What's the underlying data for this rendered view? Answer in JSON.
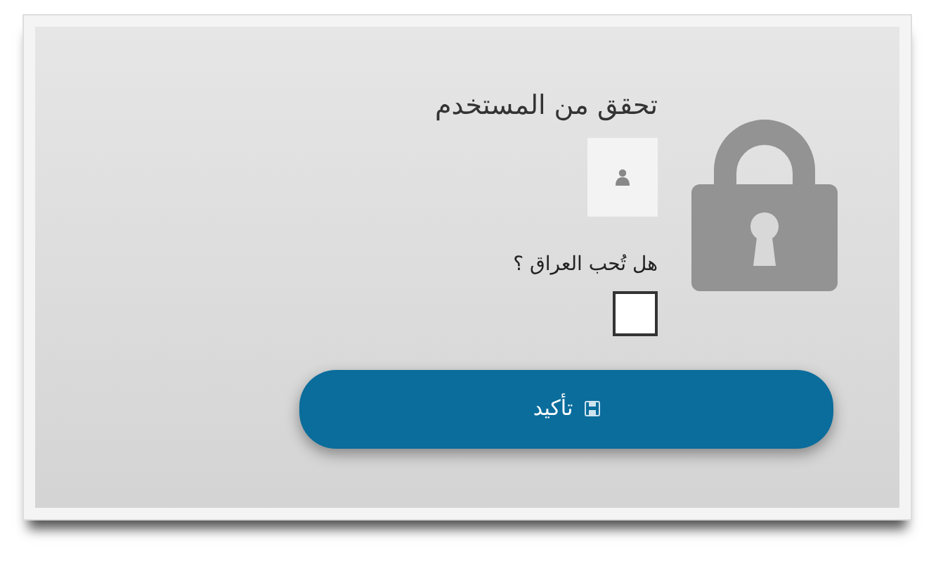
{
  "form": {
    "title": "تحقق من المستخدم",
    "question": "هل تُحب العراق ؟",
    "checkbox": {
      "checked": false
    },
    "button": {
      "label": "تأكيد"
    }
  }
}
